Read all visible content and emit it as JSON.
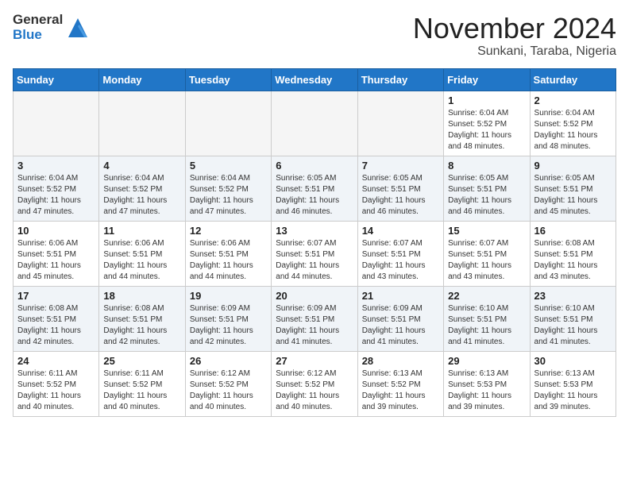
{
  "header": {
    "logo": {
      "line1": "General",
      "line2": "Blue"
    },
    "title": "November 2024",
    "location": "Sunkani, Taraba, Nigeria"
  },
  "weekdays": [
    "Sunday",
    "Monday",
    "Tuesday",
    "Wednesday",
    "Thursday",
    "Friday",
    "Saturday"
  ],
  "weeks": [
    [
      {
        "day": "",
        "empty": true
      },
      {
        "day": "",
        "empty": true
      },
      {
        "day": "",
        "empty": true
      },
      {
        "day": "",
        "empty": true
      },
      {
        "day": "",
        "empty": true
      },
      {
        "day": "1",
        "sunrise": "Sunrise: 6:04 AM",
        "sunset": "Sunset: 5:52 PM",
        "daylight": "Daylight: 11 hours and 48 minutes."
      },
      {
        "day": "2",
        "sunrise": "Sunrise: 6:04 AM",
        "sunset": "Sunset: 5:52 PM",
        "daylight": "Daylight: 11 hours and 48 minutes."
      }
    ],
    [
      {
        "day": "3",
        "sunrise": "Sunrise: 6:04 AM",
        "sunset": "Sunset: 5:52 PM",
        "daylight": "Daylight: 11 hours and 47 minutes."
      },
      {
        "day": "4",
        "sunrise": "Sunrise: 6:04 AM",
        "sunset": "Sunset: 5:52 PM",
        "daylight": "Daylight: 11 hours and 47 minutes."
      },
      {
        "day": "5",
        "sunrise": "Sunrise: 6:04 AM",
        "sunset": "Sunset: 5:52 PM",
        "daylight": "Daylight: 11 hours and 47 minutes."
      },
      {
        "day": "6",
        "sunrise": "Sunrise: 6:05 AM",
        "sunset": "Sunset: 5:51 PM",
        "daylight": "Daylight: 11 hours and 46 minutes."
      },
      {
        "day": "7",
        "sunrise": "Sunrise: 6:05 AM",
        "sunset": "Sunset: 5:51 PM",
        "daylight": "Daylight: 11 hours and 46 minutes."
      },
      {
        "day": "8",
        "sunrise": "Sunrise: 6:05 AM",
        "sunset": "Sunset: 5:51 PM",
        "daylight": "Daylight: 11 hours and 46 minutes."
      },
      {
        "day": "9",
        "sunrise": "Sunrise: 6:05 AM",
        "sunset": "Sunset: 5:51 PM",
        "daylight": "Daylight: 11 hours and 45 minutes."
      }
    ],
    [
      {
        "day": "10",
        "sunrise": "Sunrise: 6:06 AM",
        "sunset": "Sunset: 5:51 PM",
        "daylight": "Daylight: 11 hours and 45 minutes."
      },
      {
        "day": "11",
        "sunrise": "Sunrise: 6:06 AM",
        "sunset": "Sunset: 5:51 PM",
        "daylight": "Daylight: 11 hours and 44 minutes."
      },
      {
        "day": "12",
        "sunrise": "Sunrise: 6:06 AM",
        "sunset": "Sunset: 5:51 PM",
        "daylight": "Daylight: 11 hours and 44 minutes."
      },
      {
        "day": "13",
        "sunrise": "Sunrise: 6:07 AM",
        "sunset": "Sunset: 5:51 PM",
        "daylight": "Daylight: 11 hours and 44 minutes."
      },
      {
        "day": "14",
        "sunrise": "Sunrise: 6:07 AM",
        "sunset": "Sunset: 5:51 PM",
        "daylight": "Daylight: 11 hours and 43 minutes."
      },
      {
        "day": "15",
        "sunrise": "Sunrise: 6:07 AM",
        "sunset": "Sunset: 5:51 PM",
        "daylight": "Daylight: 11 hours and 43 minutes."
      },
      {
        "day": "16",
        "sunrise": "Sunrise: 6:08 AM",
        "sunset": "Sunset: 5:51 PM",
        "daylight": "Daylight: 11 hours and 43 minutes."
      }
    ],
    [
      {
        "day": "17",
        "sunrise": "Sunrise: 6:08 AM",
        "sunset": "Sunset: 5:51 PM",
        "daylight": "Daylight: 11 hours and 42 minutes."
      },
      {
        "day": "18",
        "sunrise": "Sunrise: 6:08 AM",
        "sunset": "Sunset: 5:51 PM",
        "daylight": "Daylight: 11 hours and 42 minutes."
      },
      {
        "day": "19",
        "sunrise": "Sunrise: 6:09 AM",
        "sunset": "Sunset: 5:51 PM",
        "daylight": "Daylight: 11 hours and 42 minutes."
      },
      {
        "day": "20",
        "sunrise": "Sunrise: 6:09 AM",
        "sunset": "Sunset: 5:51 PM",
        "daylight": "Daylight: 11 hours and 41 minutes."
      },
      {
        "day": "21",
        "sunrise": "Sunrise: 6:09 AM",
        "sunset": "Sunset: 5:51 PM",
        "daylight": "Daylight: 11 hours and 41 minutes."
      },
      {
        "day": "22",
        "sunrise": "Sunrise: 6:10 AM",
        "sunset": "Sunset: 5:51 PM",
        "daylight": "Daylight: 11 hours and 41 minutes."
      },
      {
        "day": "23",
        "sunrise": "Sunrise: 6:10 AM",
        "sunset": "Sunset: 5:51 PM",
        "daylight": "Daylight: 11 hours and 41 minutes."
      }
    ],
    [
      {
        "day": "24",
        "sunrise": "Sunrise: 6:11 AM",
        "sunset": "Sunset: 5:52 PM",
        "daylight": "Daylight: 11 hours and 40 minutes."
      },
      {
        "day": "25",
        "sunrise": "Sunrise: 6:11 AM",
        "sunset": "Sunset: 5:52 PM",
        "daylight": "Daylight: 11 hours and 40 minutes."
      },
      {
        "day": "26",
        "sunrise": "Sunrise: 6:12 AM",
        "sunset": "Sunset: 5:52 PM",
        "daylight": "Daylight: 11 hours and 40 minutes."
      },
      {
        "day": "27",
        "sunrise": "Sunrise: 6:12 AM",
        "sunset": "Sunset: 5:52 PM",
        "daylight": "Daylight: 11 hours and 40 minutes."
      },
      {
        "day": "28",
        "sunrise": "Sunrise: 6:13 AM",
        "sunset": "Sunset: 5:52 PM",
        "daylight": "Daylight: 11 hours and 39 minutes."
      },
      {
        "day": "29",
        "sunrise": "Sunrise: 6:13 AM",
        "sunset": "Sunset: 5:53 PM",
        "daylight": "Daylight: 11 hours and 39 minutes."
      },
      {
        "day": "30",
        "sunrise": "Sunrise: 6:13 AM",
        "sunset": "Sunset: 5:53 PM",
        "daylight": "Daylight: 11 hours and 39 minutes."
      }
    ]
  ]
}
